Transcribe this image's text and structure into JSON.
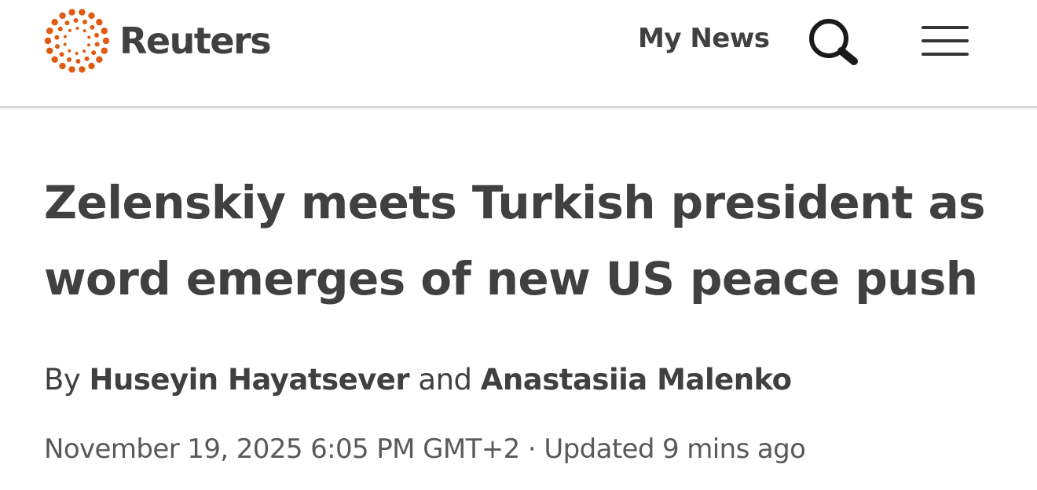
{
  "header": {
    "logo_text": "Reuters",
    "my_news_label": "My News",
    "search_icon": "search-icon",
    "menu_icon": "hamburger-menu-icon",
    "brand_color": "#e05a12"
  },
  "article": {
    "headline_line1": "Zelenskiy meets Turkish president as",
    "headline_line2": "word emerges of new US peace push",
    "byline_prefix": "By",
    "author1": "Huseyin Hayatsever",
    "byline_conjunction": "and",
    "author2": "Anastasiia Malenko",
    "published": "November 19, 2025 6:05 PM GMT+2",
    "separator": "·",
    "updated": "Updated 9 mins ago"
  }
}
